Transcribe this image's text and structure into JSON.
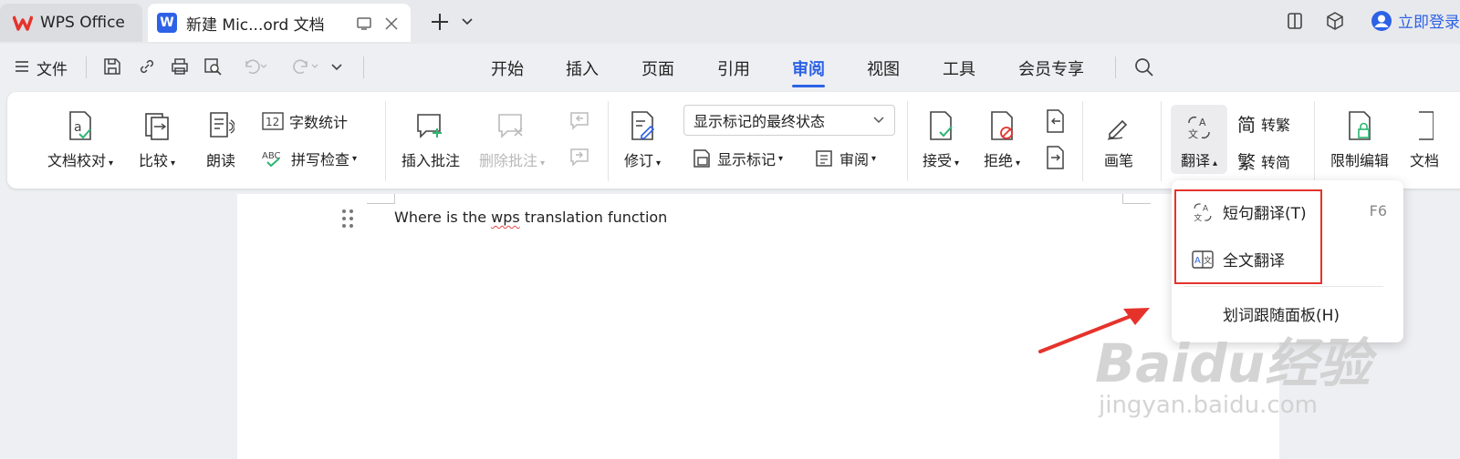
{
  "tabs": {
    "home": "WPS Office",
    "doc": "新建 Mic...ord 文档",
    "w_badge": "W"
  },
  "titlebar": {
    "login": "立即登录"
  },
  "menubar": {
    "file": "文件",
    "tabs": [
      "开始",
      "插入",
      "页面",
      "引用",
      "审阅",
      "视图",
      "工具",
      "会员专享"
    ],
    "active_tab": "审阅"
  },
  "ribbon": {
    "proofread": "文档校对",
    "compare": "比较",
    "read_aloud": "朗读",
    "word_count": "字数统计",
    "spell_check": "拼写检查",
    "insert_comment": "插入批注",
    "delete_comment": "删除批注",
    "revise": "修订",
    "markup_state": "显示标记的最终状态",
    "show_markup": "显示标记",
    "review": "审阅",
    "accept": "接受",
    "reject": "拒绝",
    "pen": "画笔",
    "translate": "翻译",
    "to_traditional": "转繁",
    "to_simplified": "转简",
    "restrict_edit": "限制编辑",
    "doc_partial": "文档"
  },
  "document": {
    "text_pre": "Where is the ",
    "text_err": "wps",
    "text_post": " translation function"
  },
  "translate_menu": {
    "short": "短句翻译(T)",
    "short_hotkey": "F6",
    "full": "全文翻译",
    "panel": "划词跟随面板(H)"
  },
  "watermark": {
    "line1": "Baidu经验",
    "line2": "jingyan.baidu.com"
  },
  "colors": {
    "accent": "#2d62e6",
    "highlight": "#e5332c",
    "brand_red": "#e5332c"
  }
}
